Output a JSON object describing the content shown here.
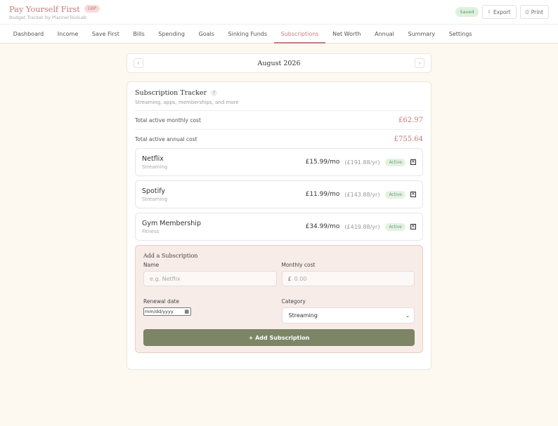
{
  "header": {
    "title": "Pay Yourself First",
    "currency": "GBP",
    "subtitle": "Budget Tracker by PlannerToolLab",
    "saved_label": "Saved",
    "export_label": "Export",
    "print_label": "Print",
    "export_icon": "download-icon",
    "print_icon": "printer-icon"
  },
  "nav": {
    "items": [
      {
        "label": "Dashboard"
      },
      {
        "label": "Income"
      },
      {
        "label": "Save First"
      },
      {
        "label": "Bills"
      },
      {
        "label": "Spending"
      },
      {
        "label": "Goals"
      },
      {
        "label": "Sinking Funds"
      },
      {
        "label": "Subscriptions"
      },
      {
        "label": "Net Worth"
      },
      {
        "label": "Annual"
      },
      {
        "label": "Summary"
      },
      {
        "label": "Settings"
      }
    ],
    "active": "Subscriptions"
  },
  "month": {
    "label": "August 2026",
    "prev_symbol": "‹",
    "next_symbol": "›"
  },
  "tracker": {
    "title": "Subscription Tracker",
    "help_symbol": "?",
    "subtitle": "Streaming, apps, memberships, and more",
    "monthly_label": "Total active monthly cost",
    "monthly_value": "£62.97",
    "annual_label": "Total active annual cost",
    "annual_value": "£755.64",
    "items": [
      {
        "name": "Netflix",
        "category": "Streaming",
        "monthly": "£15.99/mo",
        "annual": "(£191.88/yr)",
        "status": "Active"
      },
      {
        "name": "Spotify",
        "category": "Streaming",
        "monthly": "£11.99/mo",
        "annual": "(£143.88/yr)",
        "status": "Active"
      },
      {
        "name": "Gym Membership",
        "category": "Fitness",
        "monthly": "£34.99/mo",
        "annual": "(£419.88/yr)",
        "status": "Active"
      }
    ]
  },
  "add_form": {
    "title": "Add a Subscription",
    "name_label": "Name",
    "name_placeholder": "e.g. Netflix",
    "cost_label": "Monthly cost",
    "currency_symbol": "£",
    "cost_placeholder": "0.00",
    "renewal_label": "Renewal date",
    "date_placeholder": "mm/dd/yyyy",
    "category_label": "Category",
    "category_selected": "Streaming",
    "submit_label": "+ Add Subscription"
  },
  "colors": {
    "accent": "#c77b7b",
    "submit": "#7c8565",
    "background": "#fdf9f0",
    "active_badge": "#e3f2e3"
  }
}
